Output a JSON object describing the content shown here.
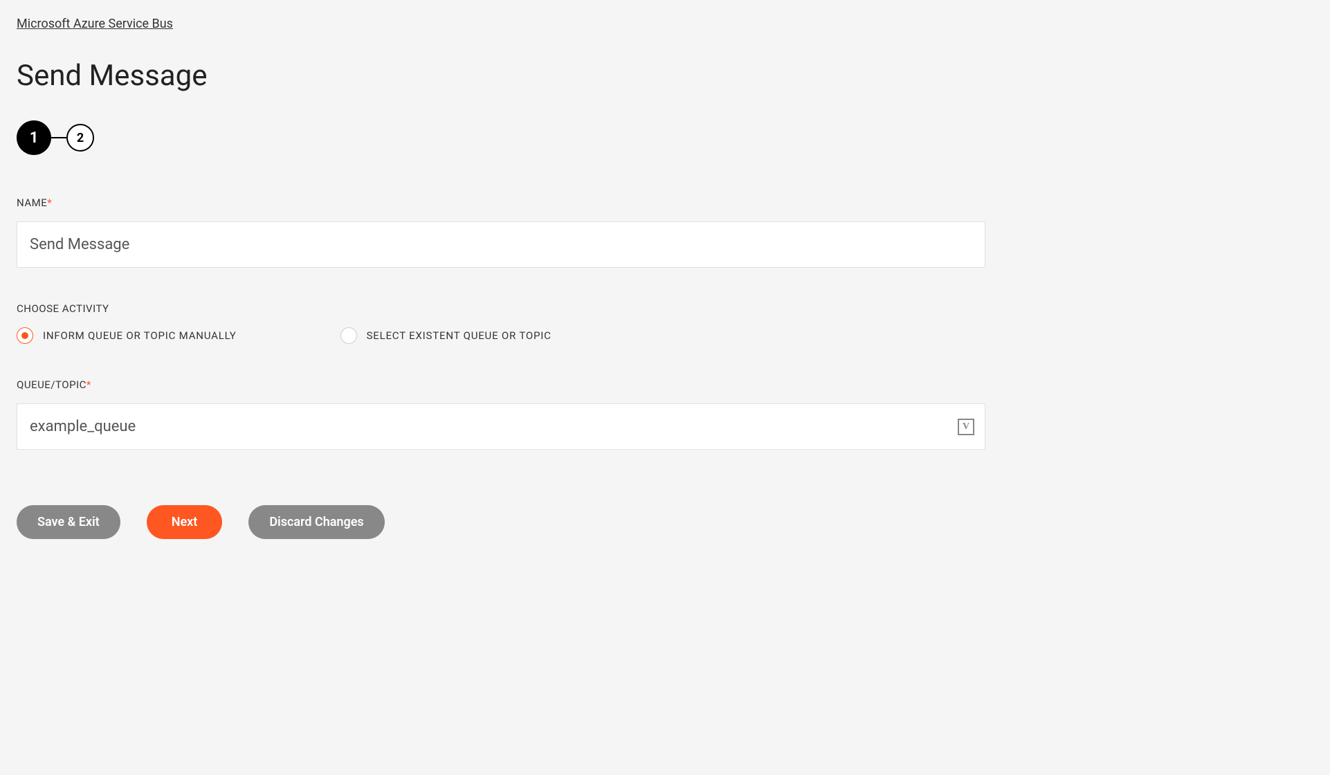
{
  "breadcrumb": "Microsoft Azure Service Bus",
  "title": "Send Message",
  "stepper": {
    "steps": [
      "1",
      "2"
    ],
    "active_index": 0
  },
  "form": {
    "name": {
      "label": "NAME",
      "required_marker": "*",
      "value": "Send Message"
    },
    "activity": {
      "label": "CHOOSE ACTIVITY",
      "options": [
        {
          "label": "INFORM QUEUE OR TOPIC MANUALLY",
          "selected": true
        },
        {
          "label": "SELECT EXISTENT QUEUE OR TOPIC",
          "selected": false
        }
      ]
    },
    "queue_topic": {
      "label": "QUEUE/TOPIC",
      "required_marker": "*",
      "value": "example_queue",
      "icon_letter": "V"
    }
  },
  "buttons": {
    "save_exit": "Save & Exit",
    "next": "Next",
    "discard": "Discard Changes"
  }
}
